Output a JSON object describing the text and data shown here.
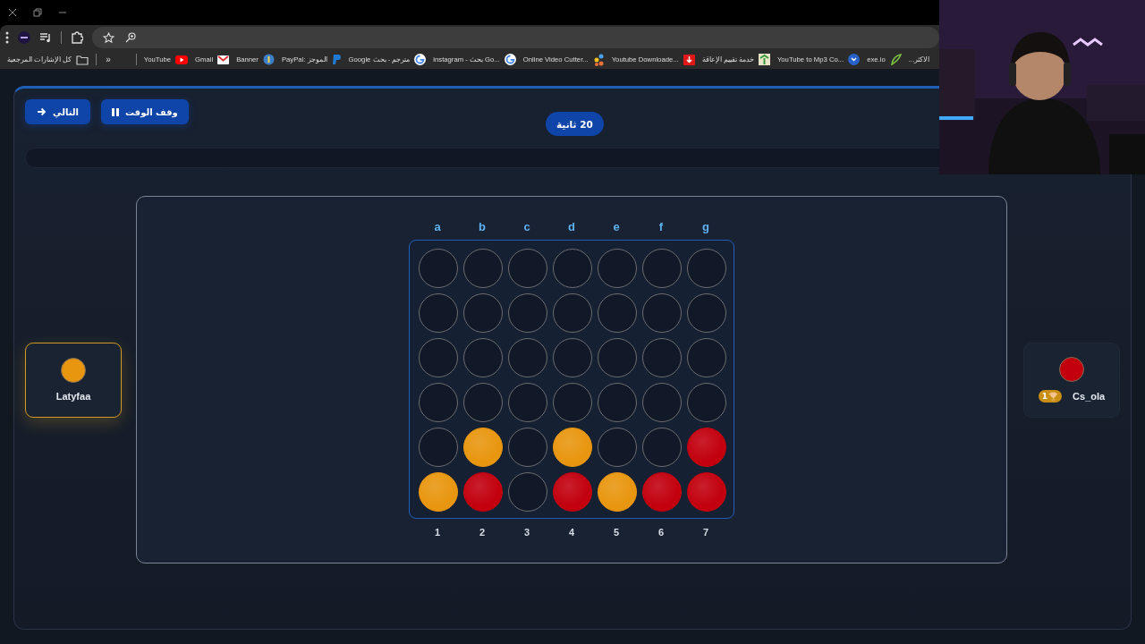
{
  "bookmarks": [
    {
      "label": "الاكثر..."
    },
    {
      "label": "exe.io"
    },
    {
      "label": "YouTube to Mp3 Co..."
    },
    {
      "label": "خدمة تقييم الإعاقة"
    },
    {
      "label": "Youtube Downloade..."
    },
    {
      "label": "Online Video Cutter..."
    },
    {
      "label": "instagram - بحث Go..."
    },
    {
      "label": "مترجم - بحث Google"
    },
    {
      "label": "PayPal: الموجز"
    },
    {
      "label": "Banner"
    },
    {
      "label": "Gmail"
    },
    {
      "label": "YouTube"
    },
    {
      "label": "»"
    },
    {
      "label": "كل الإشارات المرجعية"
    }
  ],
  "game": {
    "buttons": [
      {
        "label": "وقف الوقت",
        "kind": "pause"
      },
      {
        "label": "التالي",
        "kind": "next"
      }
    ],
    "timer": "20 ثانية",
    "columns": [
      "g",
      "f",
      "e",
      "d",
      "c",
      "b",
      "a"
    ],
    "numbers": [
      "7",
      "6",
      "5",
      "4",
      "3",
      "2",
      "1"
    ],
    "rows": [
      [
        {
          "filled": false
        },
        {
          "filled": false
        },
        {
          "filled": false
        },
        {
          "filled": false
        },
        {
          "filled": false
        },
        {
          "filled": false
        },
        {
          "filled": false
        }
      ],
      [
        {
          "filled": false
        },
        {
          "filled": false
        },
        {
          "filled": false
        },
        {
          "filled": false
        },
        {
          "filled": false
        },
        {
          "filled": false
        },
        {
          "filled": false
        }
      ],
      [
        {
          "filled": false
        },
        {
          "filled": false
        },
        {
          "filled": false
        },
        {
          "filled": false
        },
        {
          "filled": false
        },
        {
          "filled": false
        },
        {
          "filled": false
        }
      ],
      [
        {
          "filled": false
        },
        {
          "filled": false
        },
        {
          "filled": false
        },
        {
          "filled": false
        },
        {
          "filled": false
        },
        {
          "filled": false
        },
        {
          "filled": false
        }
      ],
      [
        {
          "filled": true,
          "color": "#c2000e"
        },
        {
          "filled": false
        },
        {
          "filled": false
        },
        {
          "filled": true,
          "color": "#e8960f"
        },
        {
          "filled": false
        },
        {
          "filled": true,
          "color": "#e8960f"
        },
        {
          "filled": false
        }
      ],
      [
        {
          "filled": true,
          "color": "#c2000e"
        },
        {
          "filled": true,
          "color": "#c2000e"
        },
        {
          "filled": true,
          "color": "#e8960f"
        },
        {
          "filled": true,
          "color": "#c2000e"
        },
        {
          "filled": false
        },
        {
          "filled": true,
          "color": "#c2000e"
        },
        {
          "filled": true,
          "color": "#e8960f"
        }
      ]
    ],
    "players": [
      {
        "name": "Cs_ola",
        "color": "#c2000e",
        "active": false,
        "wins": "1"
      },
      {
        "name": "Latyfaa",
        "color": "#e8960f",
        "active": true
      }
    ]
  }
}
